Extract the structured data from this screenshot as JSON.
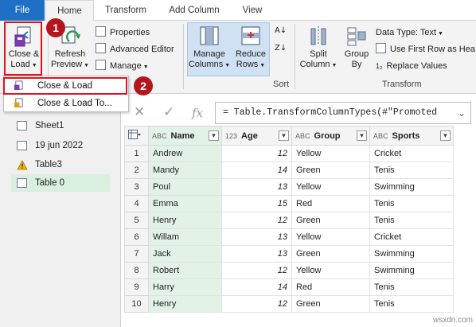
{
  "tabs": {
    "file": "File",
    "home": "Home",
    "transform": "Transform",
    "add_column": "Add Column",
    "view": "View"
  },
  "ribbon": {
    "close_load": "Close &",
    "close_load_2": "Load",
    "refresh": "Refresh",
    "refresh_2": "Preview",
    "properties": "Properties",
    "advanced_editor": "Advanced Editor",
    "manage": "Manage",
    "manage_columns": "Manage",
    "manage_columns_2": "Columns",
    "reduce_rows": "Reduce",
    "reduce_rows_2": "Rows",
    "sort_group": "Sort",
    "split_column": "Split",
    "split_column_2": "Column",
    "group_by": "Group",
    "group_by_2": "By",
    "data_type": "Data Type: Text",
    "use_first_row": "Use First Row as Hea",
    "replace_values": "Replace Values",
    "transform_group": "Transform"
  },
  "dropdown": {
    "close_load": "Close & Load",
    "close_load_to": "Close & Load To..."
  },
  "badges": {
    "one": "1",
    "two": "2"
  },
  "formula": {
    "text": "= Table.TransformColumnTypes(#\"Promoted",
    "fx": "fx"
  },
  "queries": [
    {
      "label": "Sheet1",
      "icon": "table-icon"
    },
    {
      "label": "19 jun 2022",
      "icon": "table-icon"
    },
    {
      "label": "Table3",
      "icon": "warning-icon"
    },
    {
      "label": "Table 0",
      "icon": "table-icon",
      "active": true
    }
  ],
  "table": {
    "columns": [
      {
        "type": "ABC",
        "label": "Name"
      },
      {
        "type": "123",
        "label": "Age"
      },
      {
        "type": "ABC",
        "label": "Group"
      },
      {
        "type": "ABC",
        "label": "Sports"
      }
    ],
    "rows": [
      [
        "1",
        "Andrew",
        "12",
        "Yellow",
        "Cricket"
      ],
      [
        "2",
        "Mandy",
        "14",
        "Green",
        "Tenis"
      ],
      [
        "3",
        "Poul",
        "13",
        "Yellow",
        "Swimming"
      ],
      [
        "4",
        "Emma",
        "15",
        "Red",
        "Tenis"
      ],
      [
        "5",
        "Henry",
        "12",
        "Green",
        "Tenis"
      ],
      [
        "6",
        "Willam",
        "13",
        "Yellow",
        "Cricket"
      ],
      [
        "7",
        "Jack",
        "13",
        "Green",
        "Swimming"
      ],
      [
        "8",
        "Robert",
        "12",
        "Yellow",
        "Swimming"
      ],
      [
        "9",
        "Harry",
        "14",
        "Red",
        "Tenis"
      ],
      [
        "10",
        "Henry",
        "12",
        "Green",
        "Tenis"
      ]
    ]
  },
  "watermark": "wsxdn.com",
  "colors": {
    "file_tab": "#1f6fc5",
    "highlight_red": "#e0141e",
    "badge": "#b3171d",
    "name_column": "#e3f2e6",
    "active_query": "#d9efe0"
  }
}
